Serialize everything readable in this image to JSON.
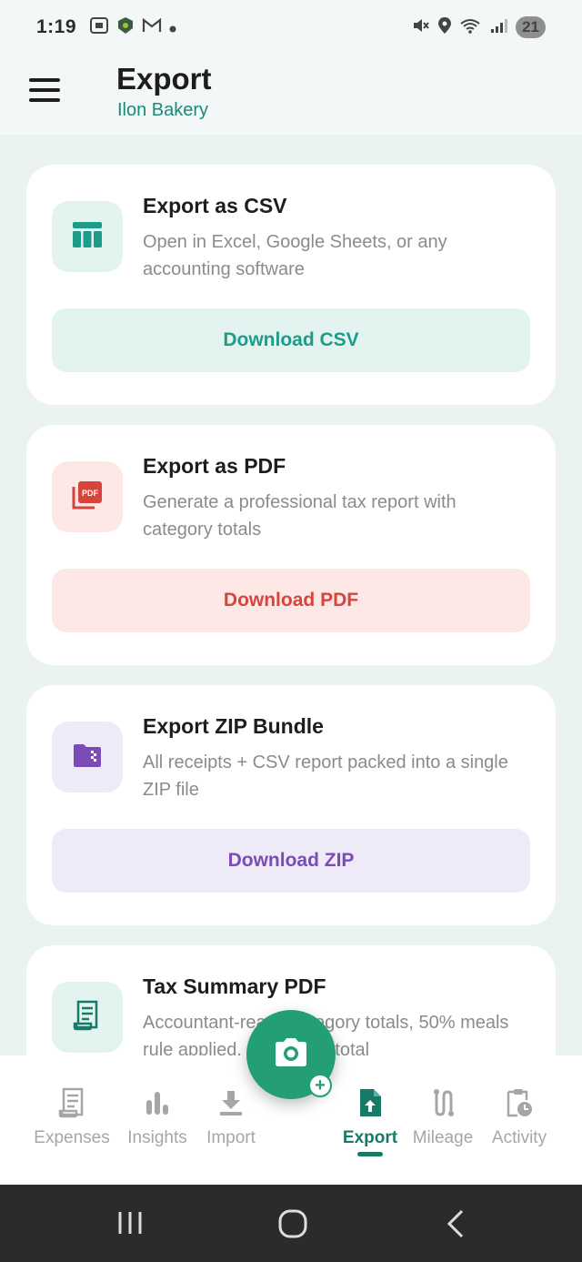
{
  "status_bar": {
    "time": "1:19",
    "left_icons": [
      "screenshot-icon",
      "security-icon",
      "gmail-icon",
      "dot-icon"
    ],
    "right_icons": [
      "mute-icon",
      "location-icon",
      "wifi-6e-icon",
      "signal-icon"
    ],
    "battery": "21"
  },
  "header": {
    "title": "Export",
    "subtitle": "Ilon Bakery"
  },
  "cards": [
    {
      "title": "Export as CSV",
      "description": "Open in Excel, Google Sheets, or any accounting software",
      "button_label": "Download CSV",
      "icon": "table-icon",
      "accent": "#1f9b89"
    },
    {
      "title": "Export as PDF",
      "description": "Generate a professional tax report with category totals",
      "button_label": "Download PDF",
      "icon": "pdf-icon",
      "accent": "#d6453d"
    },
    {
      "title": "Export ZIP Bundle",
      "description": "All receipts + CSV report packed into a single ZIP file",
      "button_label": "Download ZIP",
      "icon": "zip-folder-icon",
      "accent": "#7b4bb8"
    },
    {
      "title": "Tax Summary PDF",
      "description": "Accountant-ready category totals, 50% meals rule applied, deductible total",
      "icon": "receipt-icon",
      "accent": "#177a69"
    }
  ],
  "bottom_nav": {
    "items": [
      {
        "label": "Expenses",
        "icon": "receipt-icon"
      },
      {
        "label": "Insights",
        "icon": "bar-chart-icon"
      },
      {
        "label": "Import",
        "icon": "download-icon"
      },
      {
        "label": "Export",
        "icon": "file-upload-icon",
        "active": true
      },
      {
        "label": "Mileage",
        "icon": "route-icon"
      },
      {
        "label": "Activity",
        "icon": "clipboard-clock-icon"
      }
    ],
    "fab": {
      "icon": "camera-icon",
      "badge": "+"
    }
  },
  "colors": {
    "brand": "#177a69",
    "background": "#eaf3f0",
    "fab": "#239e77"
  }
}
